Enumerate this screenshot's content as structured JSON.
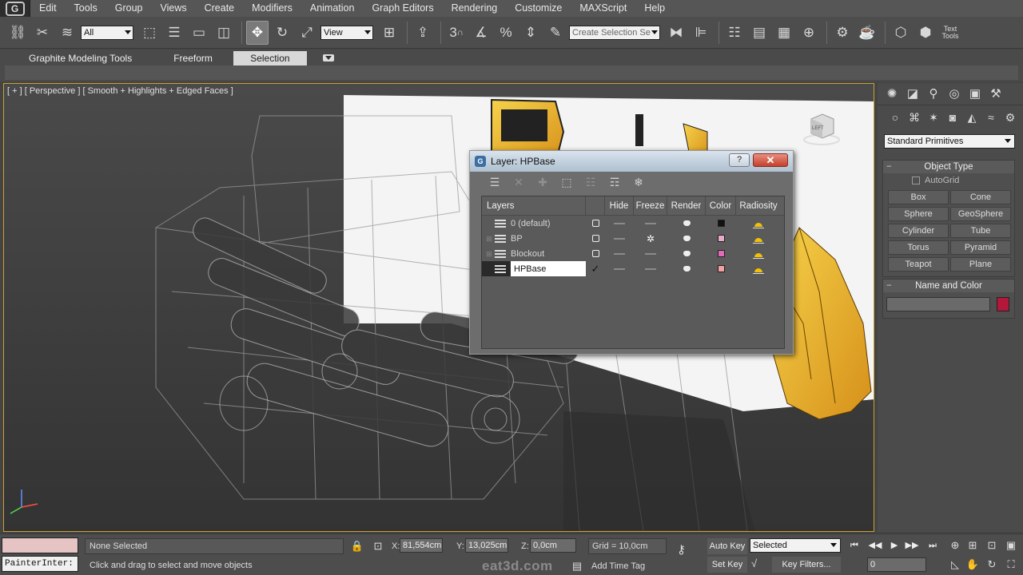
{
  "menubar": {
    "logo": "G",
    "items": [
      "Edit",
      "Tools",
      "Group",
      "Views",
      "Create",
      "Modifiers",
      "Animation",
      "Graph Editors",
      "Rendering",
      "Customize",
      "MAXScript",
      "Help"
    ]
  },
  "toolbar": {
    "filter_value": "All",
    "refcoord_value": "View",
    "snap_label": "3",
    "selection_set_placeholder": "Create Selection Se",
    "text_tools_label": "Text Tools",
    "icons": [
      "link-icon",
      "unlink-icon",
      "bind-spacewarp-icon",
      "select-object-icon",
      "select-by-name-icon",
      "rect-region-icon",
      "window-crossing-icon",
      "move-icon",
      "rotate-icon",
      "scale-icon",
      "pivot-icon",
      "manipulate-icon",
      "keyboard-shortcut-icon",
      "snap-icon",
      "angle-snap-icon",
      "percent-snap-icon",
      "spinner-snap-icon",
      "edit-named-sets-icon",
      "mirror-icon",
      "align-icon",
      "layer-manager-icon",
      "graphite-icon",
      "curve-editor-icon",
      "schematic-icon",
      "material-editor-icon",
      "render-setup-icon",
      "rendered-frame-icon",
      "render-icon"
    ]
  },
  "ribbon": {
    "tabs": [
      "Graphite Modeling Tools",
      "Freeform",
      "Selection"
    ],
    "active_tab": "Selection"
  },
  "viewport": {
    "label": "[ + ] [ Perspective ] [ Smooth + Highlights + Edged Faces ]",
    "viewcube_label": "LEFT"
  },
  "layer_dialog": {
    "title": "Layer: HPBase",
    "help_label": "?",
    "close_label": "✕",
    "tools": [
      "create-layer-icon",
      "delete-layer-icon",
      "add-selection-icon",
      "select-layer-objects-icon",
      "highlight-layer-icon",
      "hide-all-icon",
      "freeze-all-icon"
    ],
    "columns": [
      "Layers",
      "",
      "Hide",
      "Freeze",
      "Render",
      "Color",
      "Radiosity"
    ],
    "layers": [
      {
        "name": "0 (default)",
        "current": false,
        "frozen": false,
        "color": "#111111",
        "expandable": false
      },
      {
        "name": "BP",
        "current": false,
        "frozen": true,
        "color": "#e9a9c8",
        "expandable": true
      },
      {
        "name": "Blockout",
        "current": false,
        "frozen": false,
        "color": "#e06bb8",
        "expandable": true
      },
      {
        "name": "HPBase",
        "current": true,
        "frozen": false,
        "color": "#f2a0a0",
        "expandable": false
      }
    ]
  },
  "command_panel": {
    "tabs": [
      "create-tab-icon",
      "modify-tab-icon",
      "hierarchy-tab-icon",
      "motion-tab-icon",
      "display-tab-icon",
      "utilities-tab-icon"
    ],
    "subtabs": [
      "geometry-icon",
      "shapes-icon",
      "lights-icon",
      "cameras-icon",
      "helpers-icon",
      "spacewarps-icon",
      "systems-icon"
    ],
    "category": "Standard Primitives",
    "object_type_title": "Object Type",
    "autogrid_label": "AutoGrid",
    "primitives": [
      "Box",
      "Cone",
      "Sphere",
      "GeoSphere",
      "Cylinder",
      "Tube",
      "Torus",
      "Pyramid",
      "Teapot",
      "Plane"
    ],
    "name_color_title": "Name and Color",
    "name_value": "",
    "object_color": "#b3183a"
  },
  "statusbar": {
    "listener_text": "PainterInter:",
    "selection_status": "None Selected",
    "prompt": "Click and drag to select and move objects",
    "x_label": "X:",
    "x_value": "81,554cm",
    "y_label": "Y:",
    "y_value": "13,025cm",
    "z_label": "Z:",
    "z_value": "0,0cm",
    "grid": "Grid = 10,0cm",
    "add_time_tag": "Add Time Tag",
    "watermark": "eat3d.com",
    "auto_key": "Auto Key",
    "set_key": "Set Key",
    "key_mode": "Selected",
    "key_filters": "Key Filters...",
    "frame": "0"
  }
}
